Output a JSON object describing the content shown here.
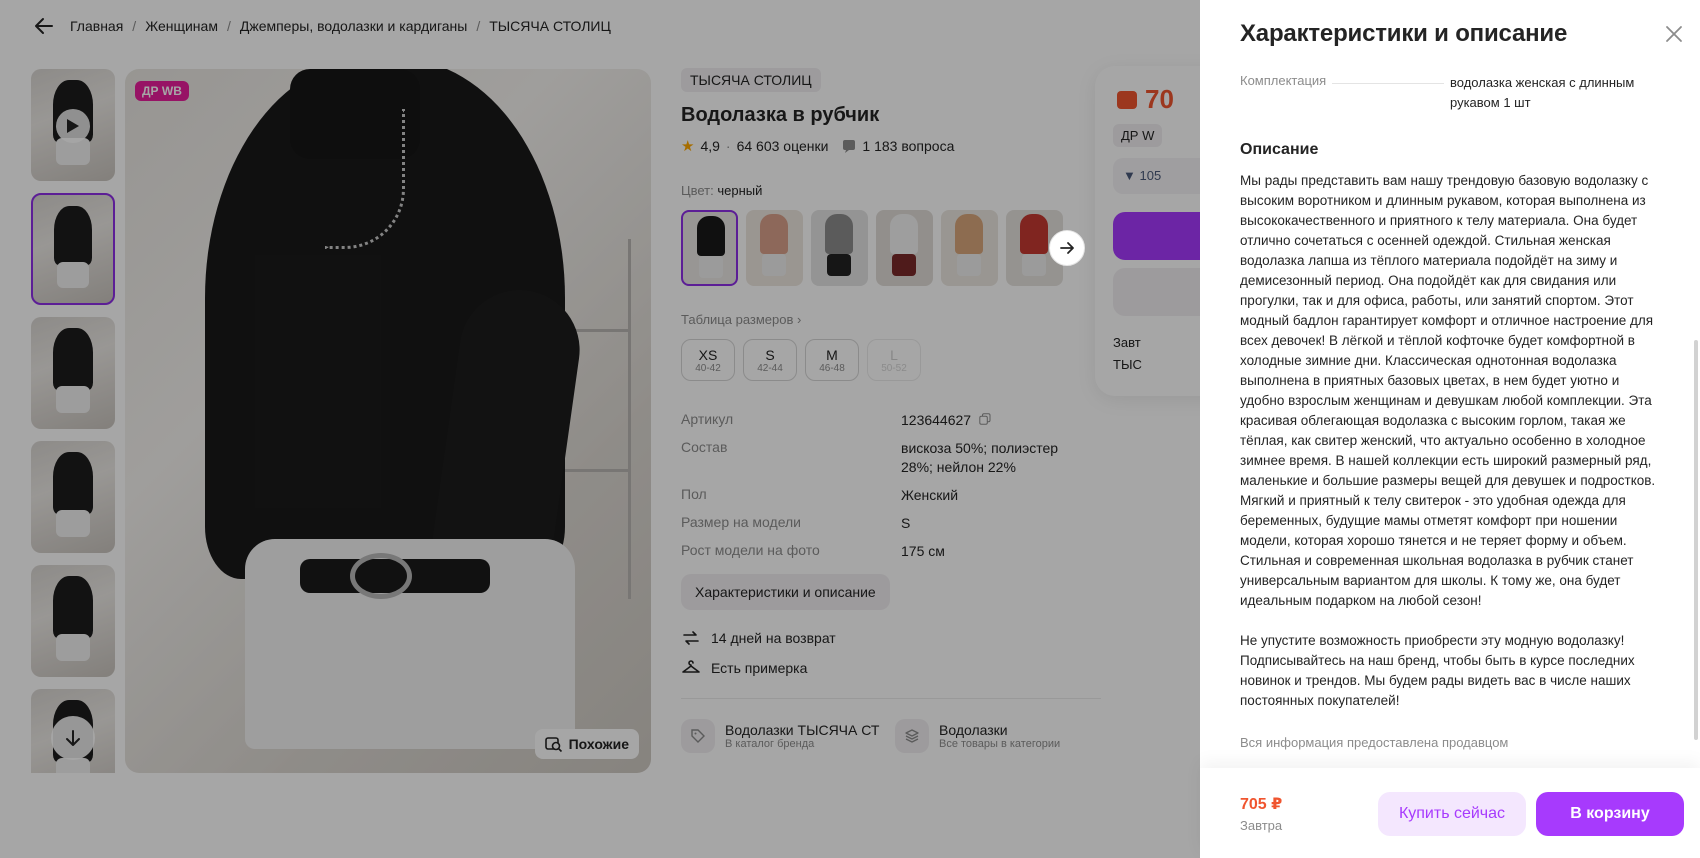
{
  "breadcrumbs": [
    "Главная",
    "Женщинам",
    "Джемперы, водолазки и кардиганы",
    "ТЫСЯЧА СТОЛИЦ"
  ],
  "gallery": {
    "badge": "ДР WB",
    "similar_label": "Похожие"
  },
  "product": {
    "brand": "ТЫСЯЧА СТОЛИЦ",
    "title": "Водолазка в рубчик",
    "rating": "4,9",
    "reviews": "64 603 оценки",
    "questions": "1 183 вопроса",
    "color_label": "Цвет:",
    "color_value": "черный",
    "size_table_label": "Таблица размеров",
    "sizes": [
      {
        "size": "XS",
        "range": "40-42",
        "available": true
      },
      {
        "size": "S",
        "range": "42-44",
        "available": true
      },
      {
        "size": "M",
        "range": "46-48",
        "available": true
      },
      {
        "size": "L",
        "range": "50-52",
        "available": false
      }
    ],
    "specs": [
      {
        "label": "Артикул",
        "value": "123644627"
      },
      {
        "label": "Состав",
        "value": "вискоза 50%; полиэстер 28%; нейлон 22%"
      },
      {
        "label": "Пол",
        "value": "Женский"
      },
      {
        "label": "Размер на модели",
        "value": "S"
      },
      {
        "label": "Рост модели на фото",
        "value": "175 см"
      }
    ],
    "chars_button": "Характеристики и описание",
    "perks": [
      "14 дней на возврат",
      "Есть примерка"
    ],
    "category_links": [
      {
        "title": "Водолазки ТЫСЯЧА СТ",
        "subtitle": "В каталог бренда"
      },
      {
        "title": "Водолазки",
        "subtitle": "Все товары в категории"
      }
    ]
  },
  "price_card": {
    "price": "70",
    "dr_chip": "ДР W",
    "old_price": "▼ 105",
    "meta": [
      "Завт",
      "ТЫС"
    ]
  },
  "panel": {
    "title": "Характеристики и описание",
    "kit_label": "Комплектация",
    "kit_value": "водолазка женская с длинным рукавом 1 шт",
    "description_title": "Описание",
    "description": "Мы рады представить вам нашу трендовую базовую водолазку с высоким воротником и длинным рукавом, которая выполнена из высококачественного и приятного к телу материала. Она будет отлично сочетаться с осенней одеждой. Стильная женская водолазка лапша из тёплого материала подойдёт на зиму и демисезонный период. Она подойдёт как для свидания или прогулки, так и для офиса, работы, или занятий спортом. Этот модный бадлон гарантирует комфорт и отличное настроение для всех девочек! В лёгкой и тёплой кофточке будет комфортной в холодные зимние дни. Классическая однотонная водолазка выполнена в приятных базовых цветах, в нем будет уютно и удобно взрослым женщинам и девушкам любой комплекции. Эта красивая облегающая водолазка с высоким горлом, такая же тёплая, как свитер женский, что актуально особенно в холодное зимнее время. В нашей коллекции есть широкий размерный ряд, маленькие и большие размеры вещей для девушек и подростков. Мягкий и приятный к телу свитерок - это удобная одежда для беременных, будущие мамы отметят комфорт при ношении модели, которая хорошо тянется и не теряет форму и объем. Стильная и современная школьная водолазка в рубчик станет универсальным вариантом для школы. К тому же, она будет идеальным подарком на любой сезон!\n\nНе упустите возможность приобрести эту модную водолазку! Подписывайтесь на наш бренд, чтобы быть в курсе последних новинок и трендов. Мы будем рады видеть вас в числе наших постоянных покупателей!",
    "seller_note": "Вся информация предоставлена продавцом",
    "footer_price": "705 ₽",
    "footer_delivery": "Завтра",
    "buy_now": "Купить сейчас",
    "add_to_cart": "В корзину"
  },
  "colors": {
    "accent": "#a73afd",
    "price": "#f0552f",
    "badge": "#e91e9c"
  },
  "swatch_colors": [
    "#1a1a1a",
    "#d9a08a",
    "#8c8c8c",
    "#e6e6e6",
    "#d9a77c",
    "#c53a32"
  ]
}
